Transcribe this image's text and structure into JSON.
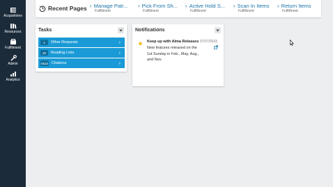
{
  "nav": {
    "items": [
      {
        "label": "Acquisitions",
        "icon": "acquisitions-icon"
      },
      {
        "label": "Resources",
        "icon": "resources-icon"
      },
      {
        "label": "Fulfillment",
        "icon": "fulfillment-icon"
      },
      {
        "label": "Admin",
        "icon": "admin-icon"
      },
      {
        "label": "Analytics",
        "icon": "analytics-icon"
      }
    ]
  },
  "recent": {
    "title": "Recent Pages",
    "items": [
      {
        "label": "Manage Patr...",
        "sub": "Fulfillment"
      },
      {
        "label": "Pick From Sh...",
        "sub": "Fulfillment"
      },
      {
        "label": "Active Hold S...",
        "sub": "Fulfillment"
      },
      {
        "label": "Scan In Items",
        "sub": "Fulfillment"
      },
      {
        "label": "Return Items",
        "sub": "Fulfillment"
      }
    ]
  },
  "tasks": {
    "title": "Tasks",
    "items": [
      {
        "count": "1",
        "label": "Other Requests"
      },
      {
        "count": "29",
        "label": "Reading Lists"
      },
      {
        "count": "6533",
        "label": "Citations"
      }
    ]
  },
  "notifications": {
    "title": "Notifications",
    "item": {
      "title": "Keep up with Alma Releases",
      "date": "07/27/2023",
      "body": "New features released on the 1st Sunday in Feb., May, Aug., and Nov."
    }
  },
  "colors": {
    "nav_bg": "#1c2b3a",
    "link": "#1a73a8",
    "task_bg": "#1a9ad6",
    "star": "#f0b400"
  }
}
